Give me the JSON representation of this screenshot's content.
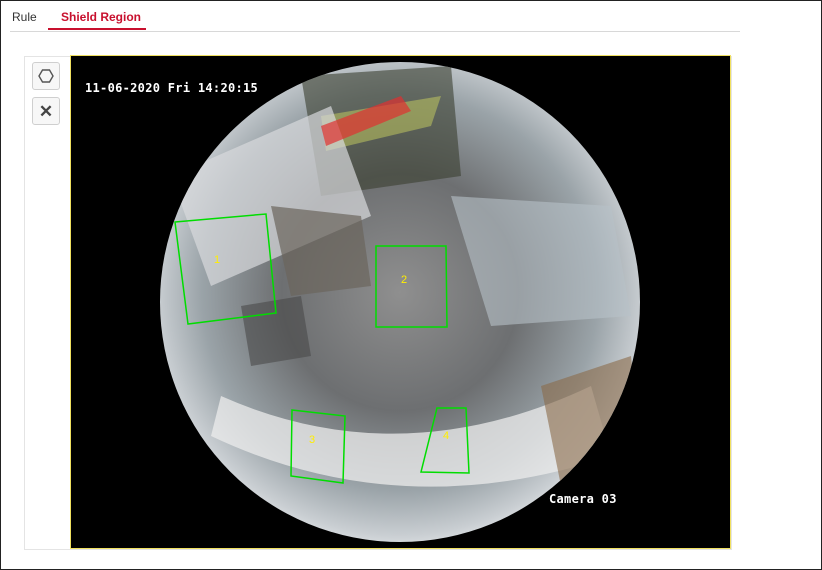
{
  "tabs": [
    {
      "label": "Rule"
    },
    {
      "label": "Shield Region"
    }
  ],
  "toolbar": {
    "polygon_tool_icon": "hexagon-icon",
    "clear_tool_icon": "close-icon",
    "clear_glyph": "✕"
  },
  "video": {
    "timestamp": "11-06-2020 Fri 14:20:15",
    "camera_label": "Camera 03",
    "shield_regions": [
      {
        "label": "1"
      },
      {
        "label": "2"
      },
      {
        "label": "3"
      },
      {
        "label": "4"
      }
    ],
    "region_color": "#00dd00",
    "region_label_color": "#ffee00"
  },
  "colors": {
    "accent": "#c8102e"
  }
}
